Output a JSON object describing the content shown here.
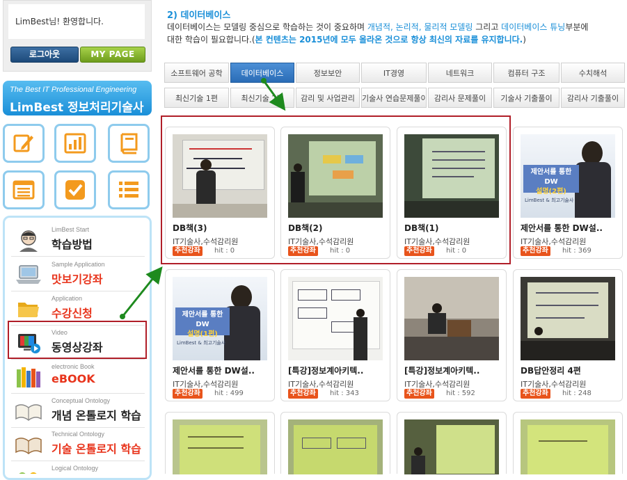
{
  "sidebar": {
    "welcome": "LimBest님! 환영합니다.",
    "logout_label": "로그아웃",
    "mypage_label": "MY PAGE",
    "banner_top": "The Best IT Professional Engineering",
    "banner_bottom": "LimBest 정보처리기술사",
    "icon_tiles": [
      "pencil-icon",
      "bar-chart-icon",
      "book-icon",
      "list-window-icon",
      "checkbox-icon",
      "bullet-list-icon"
    ],
    "menu": [
      {
        "sub": "LimBest Start",
        "main": "학습방법",
        "icon": "student-avatar-icon",
        "color": "black"
      },
      {
        "sub": "Sample Application",
        "main": "맛보기강좌",
        "icon": "laptop-icon",
        "color": "red"
      },
      {
        "sub": "Application",
        "main": "수강신청",
        "icon": "folder-icon",
        "color": "red"
      },
      {
        "sub": "Video",
        "main": "동영상강좌",
        "icon": "video-monitor-icon",
        "color": "black"
      },
      {
        "sub": "electronic Book",
        "main": "eBOOK",
        "icon": "books-icon",
        "color": "red"
      },
      {
        "sub": "Conceptual Ontology",
        "main": "개념 온톨로지 학습",
        "icon": "open-book-icon",
        "color": "black"
      },
      {
        "sub": "Technical Ontology",
        "main": "기술 온톨로지 학습",
        "icon": "open-book-icon",
        "color": "red"
      },
      {
        "sub": "Logical Ontology",
        "main": "",
        "icon": "logic-icon",
        "color": "black"
      }
    ]
  },
  "content": {
    "section_title": "2) 데이터베이스",
    "desc": {
      "p1": "데이터베이스는 모델링 중심으로 학습하는 것이 중요하며 ",
      "h1": "개념적, 논리적, 물리적 모델링",
      "p2": " 그리고 ",
      "h2": "데이터베이스 튜닝",
      "p3": "부분에",
      "p4": "대한 학습이 필요합니다.(",
      "h3": "본 컨텐츠는 2015년에 모두 올라온 것으로 항상 최신의 자료를 유지합니다.",
      "p5": ")"
    },
    "tabs_row1": [
      "소프트웨어 공학",
      "데이터베이스",
      "정보보안",
      "IT경영",
      "네트워크",
      "컴퓨터 구조",
      "수치해석"
    ],
    "tabs_row2": [
      "최신기술 1편",
      "최신기술 2편",
      "감리 및 사업관리",
      "기술사 연습문제풀이",
      "감리사 문제풀이",
      "기술사 기출풀이",
      "감리사 기출풀이"
    ],
    "active_tab": "데이터베이스",
    "cards": [
      {
        "title": "DB책(3)",
        "author": "IT기술사,수석감리원",
        "badge": "추천강좌",
        "hit": "hit : 0"
      },
      {
        "title": "DB책(2)",
        "author": "IT기술사,수석감리원",
        "badge": "추천강좌",
        "hit": "hit : 0"
      },
      {
        "title": "DB책(1)",
        "author": "IT기술사,수석감리원",
        "badge": "추천강좌",
        "hit": "hit : 0"
      },
      {
        "title": "제안서를 통한 DW설..",
        "author": "IT기술사,수석감리원",
        "badge": "추천강좌",
        "hit": "hit : 369"
      },
      {
        "title": "제안서를 통한 DW설..",
        "author": "IT기술사,수석감리원",
        "badge": "추천강좌",
        "hit": "hit : 499"
      },
      {
        "title": "[특강]정보계아키텍..",
        "author": "IT기술사,수석감리원",
        "badge": "추천강좌",
        "hit": "hit : 343"
      },
      {
        "title": "[특강]정보계아키텍..",
        "author": "IT기술사,수석감리원",
        "badge": "추천강좌",
        "hit": "hit : 592"
      },
      {
        "title": "DB답안정리 4편",
        "author": "IT기술사,수석감리원",
        "badge": "추천강좌",
        "hit": "hit : 248"
      },
      {
        "title": "",
        "author": "",
        "badge": "",
        "hit": ""
      },
      {
        "title": "",
        "author": "",
        "badge": "",
        "hit": ""
      },
      {
        "title": "",
        "author": "",
        "badge": "",
        "hit": ""
      },
      {
        "title": "",
        "author": "",
        "badge": "",
        "hit": ""
      }
    ],
    "thumb_overlay": {
      "line1": "제안서를 통한 DW",
      "line2": "설명(1편)",
      "line2b": "설명(2편)",
      "brand": "LimBest & 최고기술사"
    }
  },
  "colors": {
    "accent_blue": "#1a8fd8",
    "badge_orange": "#e8541c",
    "highlight_red": "#b01e28",
    "arrow_green": "#1e8a1e"
  }
}
